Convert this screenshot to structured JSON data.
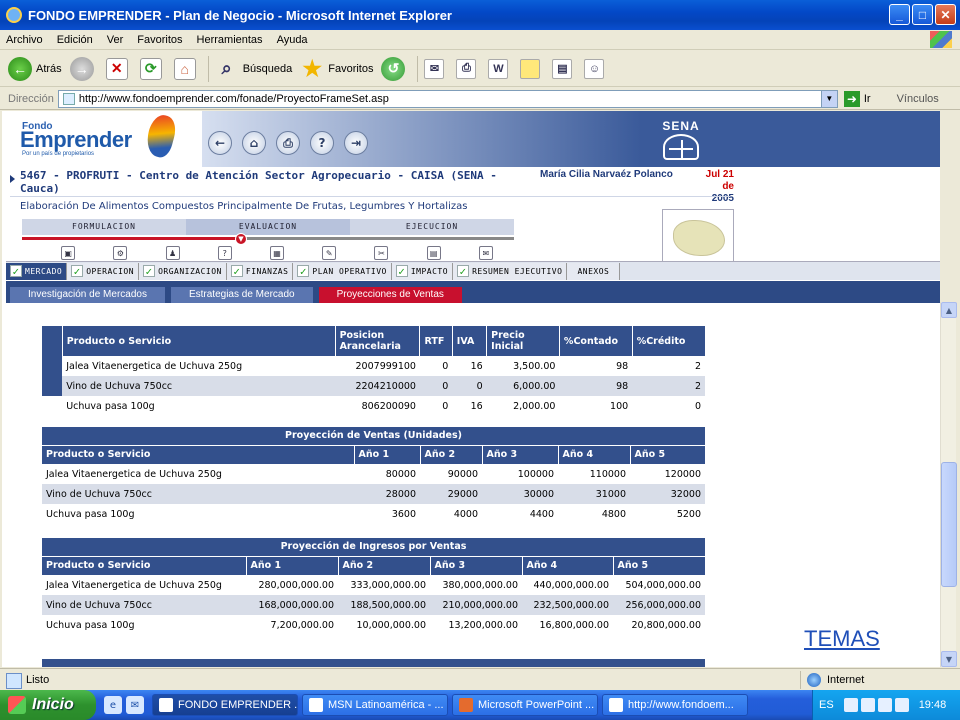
{
  "window": {
    "title": "FONDO EMPRENDER - Plan de Negocio - Microsoft Internet Explorer"
  },
  "menu": [
    "Archivo",
    "Edición",
    "Ver",
    "Favoritos",
    "Herramientas",
    "Ayuda"
  ],
  "toolbar": {
    "back_label": "Atrás",
    "search_label": "Búsqueda",
    "favorites_label": "Favoritos"
  },
  "address": {
    "label": "Dirección",
    "url": "http://www.fondoemprender.com/fonade/ProyectoFrameSet.asp",
    "go_label": "Ir",
    "links_label": "Vínculos"
  },
  "header": {
    "logo_top": "Fondo",
    "logo_main": "Emprender",
    "logo_tagline": "Por un país de propietarios",
    "sena_label": "SENA",
    "project_title": "5467 - PROFRUTI - Centro de Atención Sector Agropecuario - CAISA (SENA - Cauca)",
    "user_name": "María Cilia Narvaéz Polanco",
    "date_line1": "Jul 21 de",
    "date_line2": "2005",
    "subtitle": "Elaboración De Alimentos Compuestos Principalmente De Frutas, Legumbres Y Hortalizas"
  },
  "phases": [
    "FORMULACION",
    "EVALUACION",
    "EJECUCION"
  ],
  "tabs": [
    {
      "label": "MERCADO",
      "checked": true,
      "selected": true
    },
    {
      "label": "OPERACION",
      "checked": true
    },
    {
      "label": "ORGANIZACION",
      "checked": true
    },
    {
      "label": "FINANZAS",
      "checked": true
    },
    {
      "label": "PLAN OPERATIVO",
      "checked": true
    },
    {
      "label": "IMPACTO",
      "checked": true
    },
    {
      "label": "RESUMEN EJECUTIVO",
      "checked": true
    },
    {
      "label": "ANEXOS",
      "checked": false
    }
  ],
  "subtabs": [
    {
      "label": "Investigación de Mercados",
      "selected": false
    },
    {
      "label": "Estrategias de Mercado",
      "selected": false
    },
    {
      "label": "Proyecciones de Ventas",
      "selected": true
    }
  ],
  "products_table": {
    "headers": [
      "Producto o Servicio",
      "Posicion Arancelaria",
      "RTF",
      "IVA",
      "Precio Inicial",
      "%Contado",
      "%Crédito"
    ],
    "rows": [
      [
        "Jalea Vitaenergetica de Uchuva 250g",
        "2007999100",
        "0",
        "16",
        "3,500.00",
        "98",
        "2"
      ],
      [
        "Vino de Uchuva 750cc",
        "2204210000",
        "0",
        "0",
        "6,000.00",
        "98",
        "2"
      ],
      [
        "Uchuva pasa 100g",
        "806200090",
        "0",
        "16",
        "2,000.00",
        "100",
        "0"
      ]
    ]
  },
  "units_table": {
    "caption": "Proyección de Ventas (Unidades)",
    "headers": [
      "Producto o Servicio",
      "Año 1",
      "Año 2",
      "Año 3",
      "Año 4",
      "Año 5"
    ],
    "rows": [
      [
        "Jalea Vitaenergetica de Uchuva 250g",
        "80000",
        "90000",
        "100000",
        "110000",
        "120000"
      ],
      [
        "Vino de Uchuva 750cc",
        "28000",
        "29000",
        "30000",
        "31000",
        "32000"
      ],
      [
        "Uchuva pasa 100g",
        "3600",
        "4000",
        "4400",
        "4800",
        "5200"
      ]
    ]
  },
  "revenue_table": {
    "caption": "Proyección de Ingresos por Ventas",
    "headers": [
      "Producto o Servicio",
      "Año 1",
      "Año 2",
      "Año 3",
      "Año 4",
      "Año 5"
    ],
    "rows": [
      [
        "Jalea Vitaenergetica de Uchuva 250g",
        "280,000,000.00",
        "333,000,000.00",
        "380,000,000.00",
        "440,000,000.00",
        "504,000,000.00"
      ],
      [
        "Vino de Uchuva 750cc",
        "168,000,000.00",
        "188,500,000.00",
        "210,000,000.00",
        "232,500,000.00",
        "256,000,000.00"
      ],
      [
        "Uchuva pasa 100g",
        "7,200,000.00",
        "10,000,000.00",
        "13,200,000.00",
        "16,800,000.00",
        "20,800,000.00"
      ]
    ]
  },
  "temas_link": "TEMAS",
  "status": {
    "text": "Listo",
    "zone": "Internet"
  },
  "taskbar": {
    "start_label": "Inicio",
    "tasks": [
      {
        "label": "FONDO EMPRENDER ...",
        "active": true
      },
      {
        "label": "MSN Latinoamérica - ...",
        "active": false
      },
      {
        "label": "Microsoft PowerPoint ...",
        "active": false
      },
      {
        "label": "http://www.fondoem...",
        "active": false
      }
    ],
    "lang": "ES",
    "clock": "19:48"
  }
}
